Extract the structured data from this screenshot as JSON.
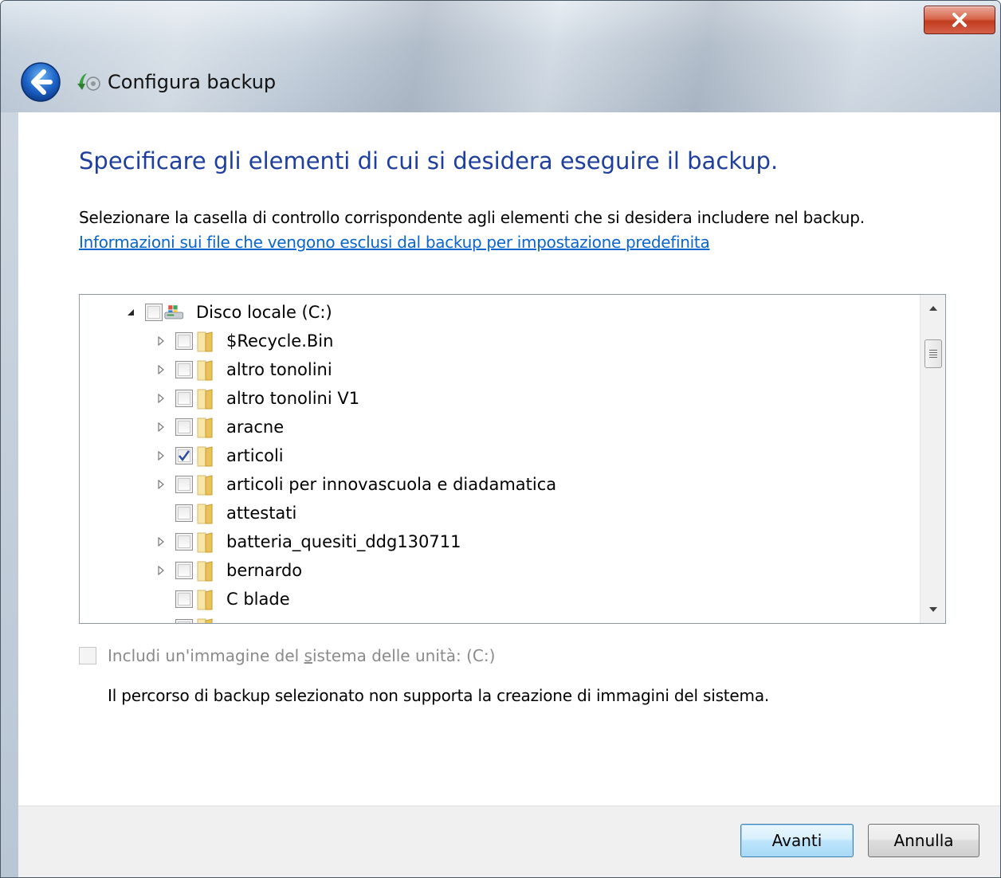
{
  "window": {
    "title": "Configura backup",
    "close_icon": "close-icon",
    "back_icon": "back-arrow-icon",
    "accent": "#1e3f9e",
    "link_color": "#0a66cc"
  },
  "page": {
    "heading": "Specificare gli elementi di cui si desidera eseguire il backup.",
    "instruction": "Selezionare la casella di controllo corrispondente agli elementi che si desidera includere nel backup.",
    "link": "Informazioni sui file che vengono esclusi dal backup per impostazione predefinita"
  },
  "tree": {
    "root": {
      "label": "Disco locale (C:)",
      "expanded": true,
      "checked": false,
      "icon": "drive-icon"
    },
    "items": [
      {
        "label": "$Recycle.Bin",
        "expandable": true,
        "checked": false,
        "icon": "folder-icon"
      },
      {
        "label": "altro tonolini",
        "expandable": true,
        "checked": false,
        "icon": "folder-icon"
      },
      {
        "label": "altro tonolini V1",
        "expandable": true,
        "checked": false,
        "icon": "folder-icon"
      },
      {
        "label": "aracne",
        "expandable": true,
        "checked": false,
        "icon": "folder-icon"
      },
      {
        "label": "articoli",
        "expandable": true,
        "checked": true,
        "icon": "folder-icon"
      },
      {
        "label": "articoli per innovascuola e diadamatica",
        "expandable": true,
        "checked": false,
        "icon": "folder-icon"
      },
      {
        "label": "attestati",
        "expandable": false,
        "checked": false,
        "icon": "folder-icon"
      },
      {
        "label": "batteria_quesiti_ddg130711",
        "expandable": true,
        "checked": false,
        "icon": "folder-icon"
      },
      {
        "label": "bernardo",
        "expandable": true,
        "checked": false,
        "icon": "folder-icon"
      },
      {
        "label": "C blade",
        "expandable": false,
        "checked": false,
        "icon": "folder-icon"
      }
    ]
  },
  "system_image": {
    "label_before": "Includi un'immagine del ",
    "label_accel": "s",
    "label_after": "istema delle unità: (C:)",
    "checked": false,
    "disabled": true
  },
  "note": "Il percorso di backup selezionato non supporta la creazione di immagini del sistema.",
  "buttons": {
    "next": "Avanti",
    "cancel": "Annulla"
  }
}
